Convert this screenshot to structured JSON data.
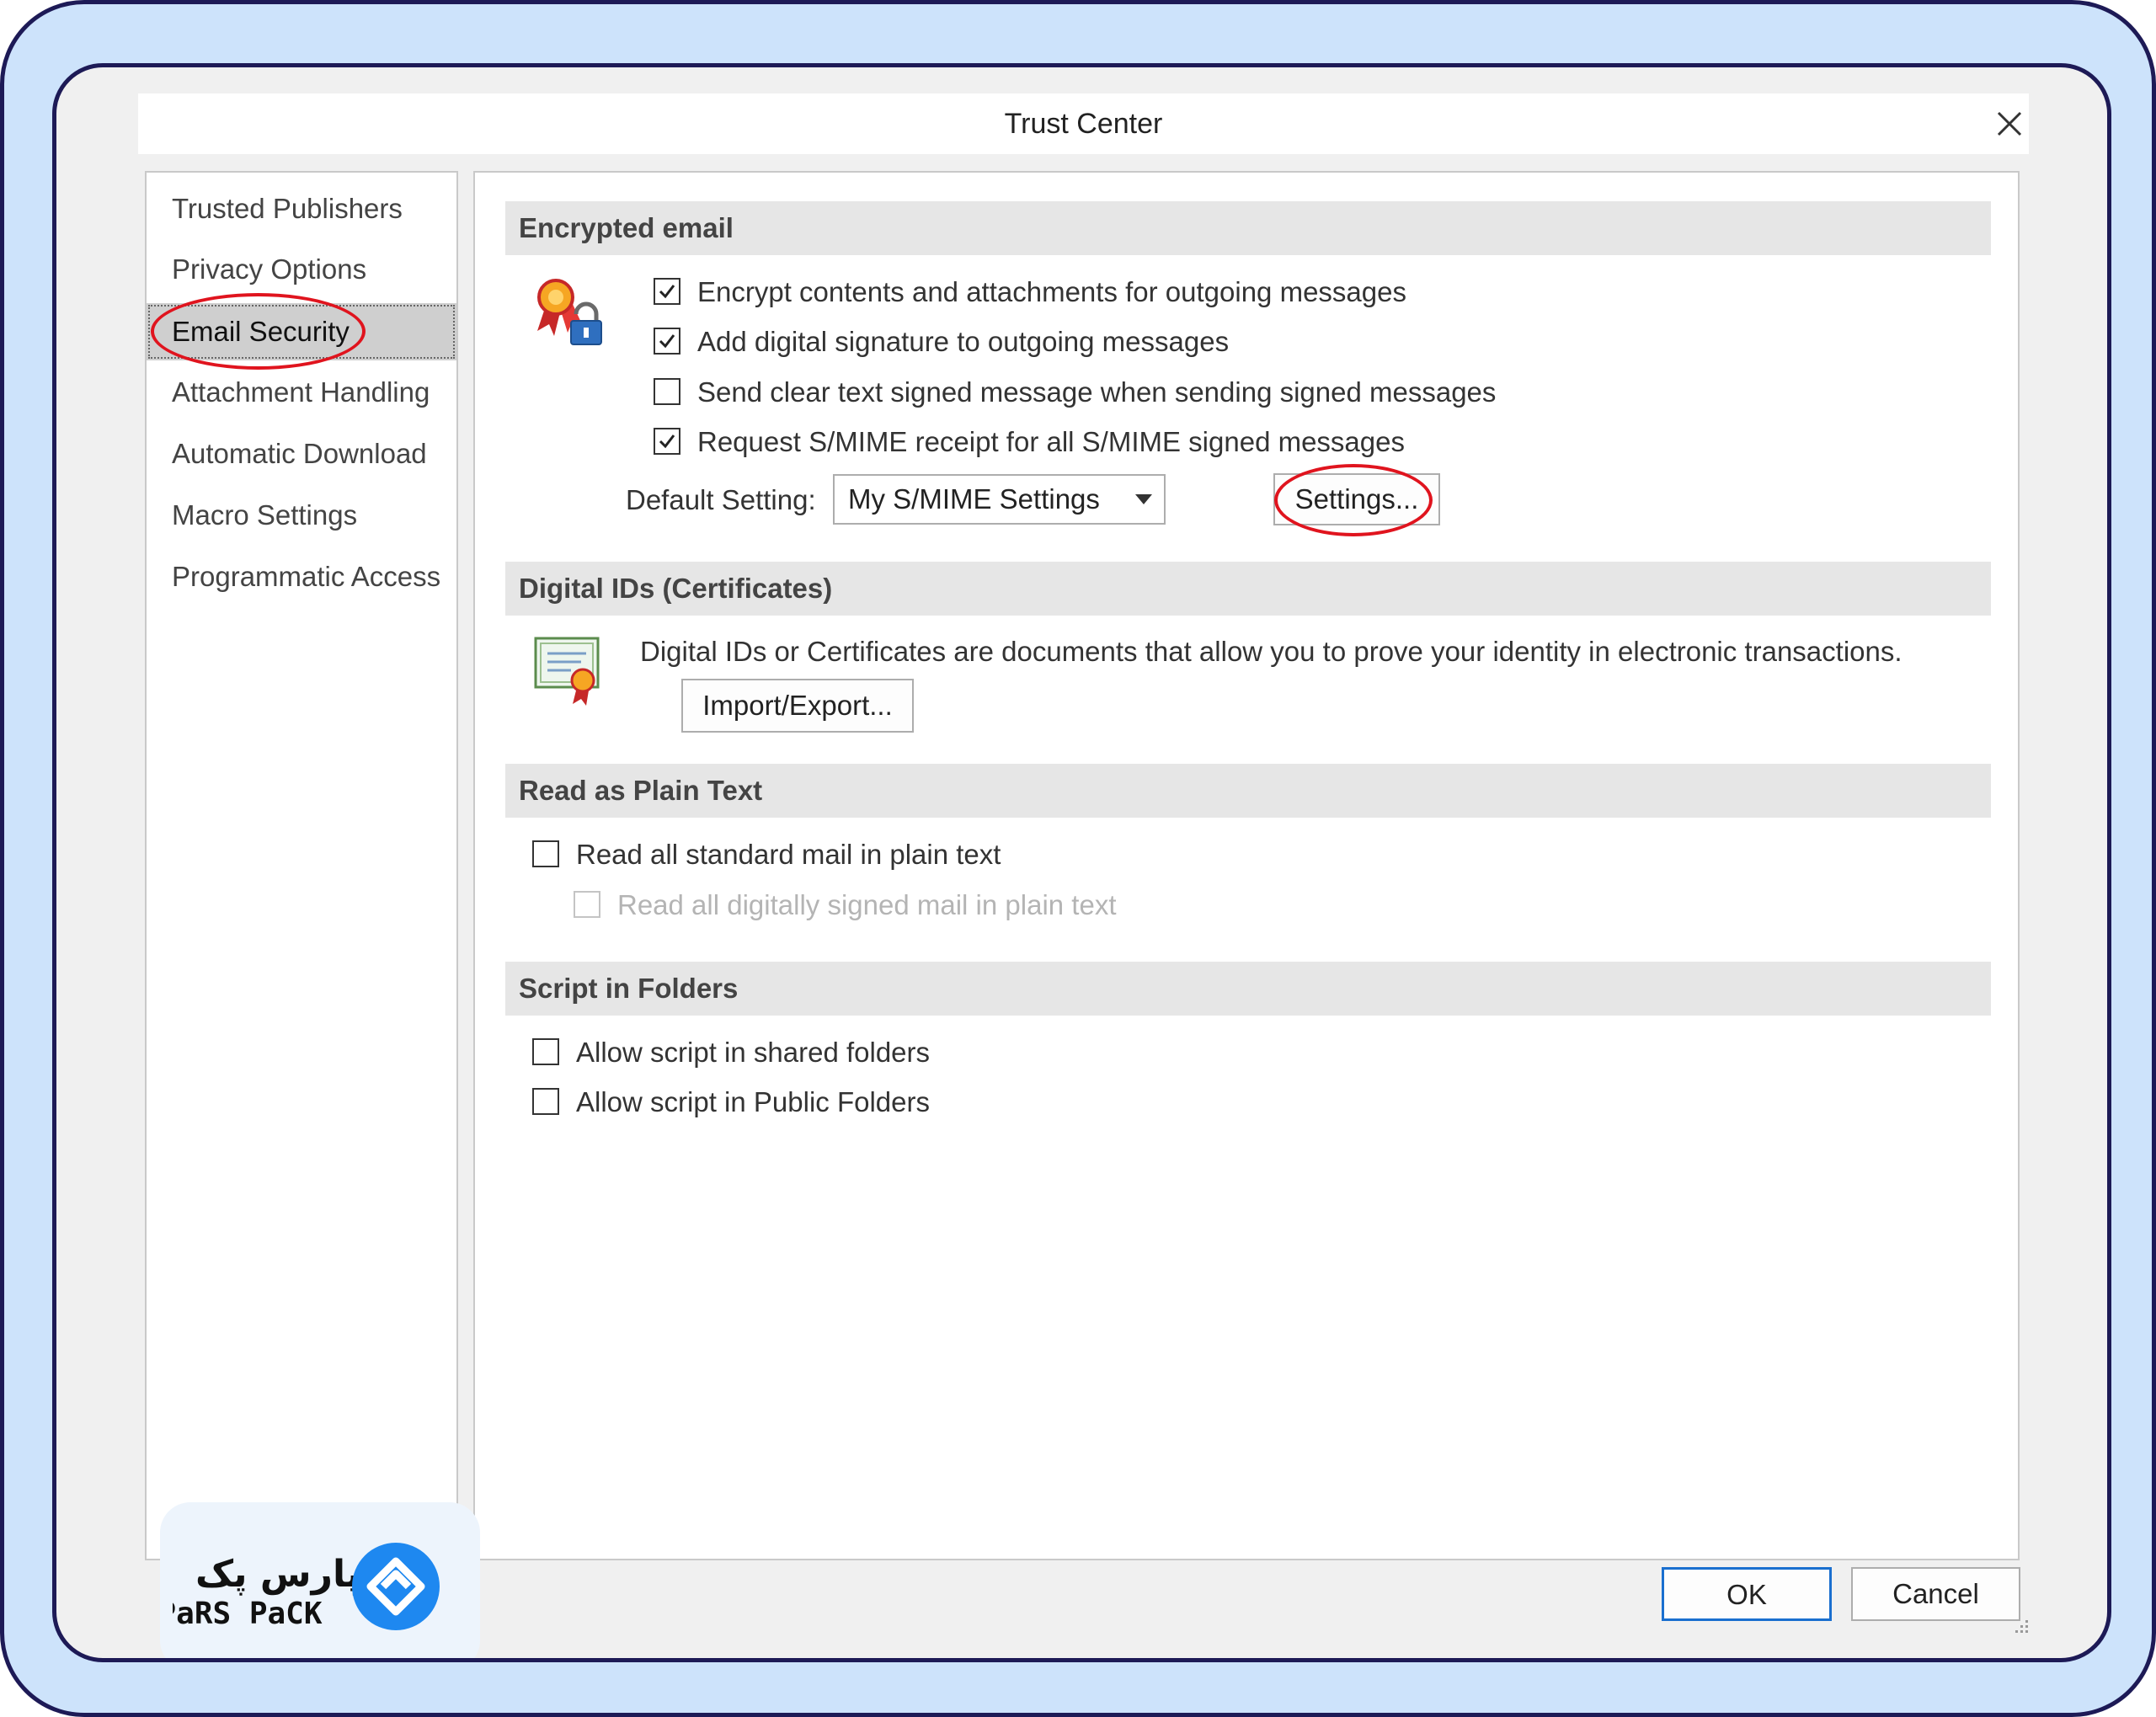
{
  "window": {
    "title": "Trust Center",
    "close_symbol": "×"
  },
  "sidebar": {
    "items": [
      {
        "label": "Trusted Publishers",
        "selected": false
      },
      {
        "label": "Privacy Options",
        "selected": false
      },
      {
        "label": "Email Security",
        "selected": true
      },
      {
        "label": "Attachment Handling",
        "selected": false
      },
      {
        "label": "Automatic Download",
        "selected": false
      },
      {
        "label": "Macro Settings",
        "selected": false
      },
      {
        "label": "Programmatic Access",
        "selected": false
      }
    ]
  },
  "sections": {
    "encrypted_email": {
      "heading": "Encrypted email",
      "options": [
        {
          "label": "Encrypt contents and attachments for outgoing messages",
          "checked": true
        },
        {
          "label": "Add digital signature to outgoing messages",
          "checked": true
        },
        {
          "label": "Send clear text signed message when sending signed messages",
          "checked": false
        },
        {
          "label": "Request S/MIME receipt for all S/MIME signed messages",
          "checked": true
        }
      ],
      "default_setting_label": "Default Setting:",
      "default_setting_value": "My S/MIME Settings",
      "settings_button": "Settings..."
    },
    "digital_ids": {
      "heading": "Digital IDs (Certificates)",
      "description": "Digital IDs or Certificates are documents that allow you to prove your identity in electronic transactions.",
      "import_export_button": "Import/Export..."
    },
    "plain_text": {
      "heading": "Read as Plain Text",
      "options": [
        {
          "label": "Read all standard mail in plain text",
          "checked": false,
          "enabled": true
        },
        {
          "label": "Read all digitally signed mail in plain text",
          "checked": false,
          "enabled": false
        }
      ]
    },
    "script_in_folders": {
      "heading": "Script in Folders",
      "options": [
        {
          "label": "Allow script in shared folders",
          "checked": false
        },
        {
          "label": "Allow script in Public Folders",
          "checked": false
        }
      ]
    }
  },
  "footer": {
    "ok": "OK",
    "cancel": "Cancel"
  },
  "brand": {
    "name_fa": "پارس پک",
    "name_en": "PaRS PaCK",
    "color": "#1e88f0"
  },
  "colors": {
    "highlight": "#e0141e",
    "frame": "#1d1a56",
    "background": "#cde3fb",
    "ok_border": "#1a6fcf"
  },
  "icons": [
    "close-icon",
    "encryption-ribbon-lock-icon",
    "certificate-icon",
    "dropdown-arrow-icon",
    "parspack-logo-icon",
    "resize-grip-icon"
  ]
}
